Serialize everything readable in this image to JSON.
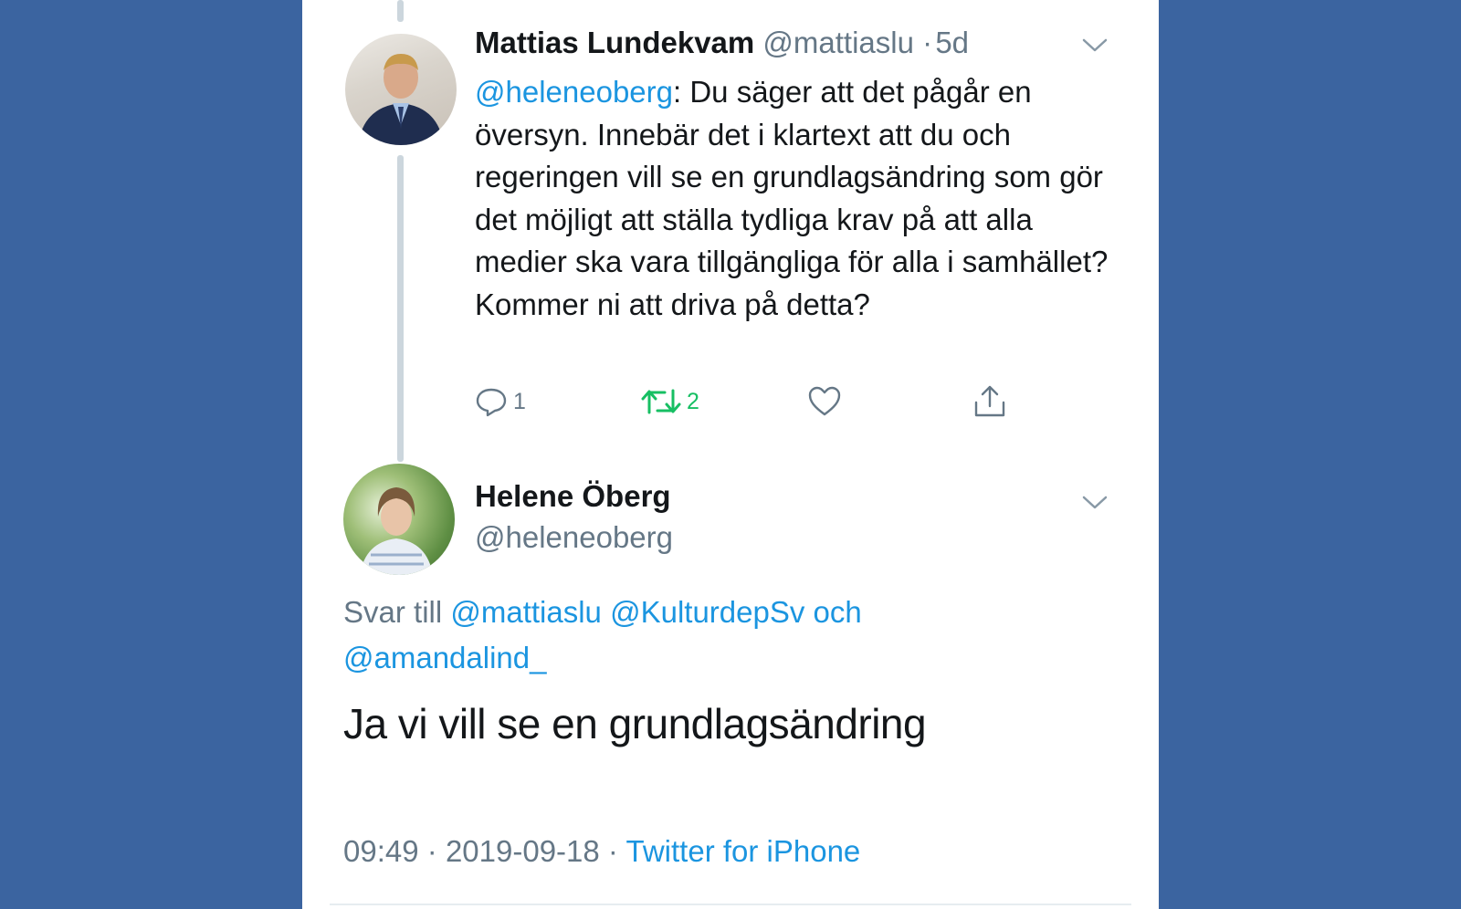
{
  "thread": {
    "parent": {
      "author_name": "Mattias Lundekvam",
      "author_handle": "@mattiaslu",
      "separator": "·",
      "time_ago": "5d",
      "mention": "@heleneoberg",
      "text_rest": ": Du säger att det pågår en översyn. Innebär det i klartext att du och regeringen vill se en grundlagsändring som gör det möjligt att ställa tydliga krav på att alla medier ska vara tillgängliga för alla i samhället? Kommer ni att driva på detta?",
      "reply_count": "1",
      "retweet_count": "2",
      "retweet_color": "#17bf63"
    },
    "reply": {
      "author_name": "Helene Öberg",
      "author_handle": "@heleneoberg",
      "reply_prefix": "Svar till",
      "reply_mention_1": "@mattiaslu",
      "reply_mention_2": "@KulturdepSv",
      "reply_and": "och",
      "reply_mention_3": "@amandalind_",
      "text": "Ja vi vill se en grundlagsändring",
      "time": "09:49",
      "date": "2019-09-18",
      "separator": "·",
      "source": "Twitter for iPhone"
    }
  },
  "colors": {
    "background": "#3b64a0",
    "link": "#1b95e0",
    "muted": "#657786"
  }
}
